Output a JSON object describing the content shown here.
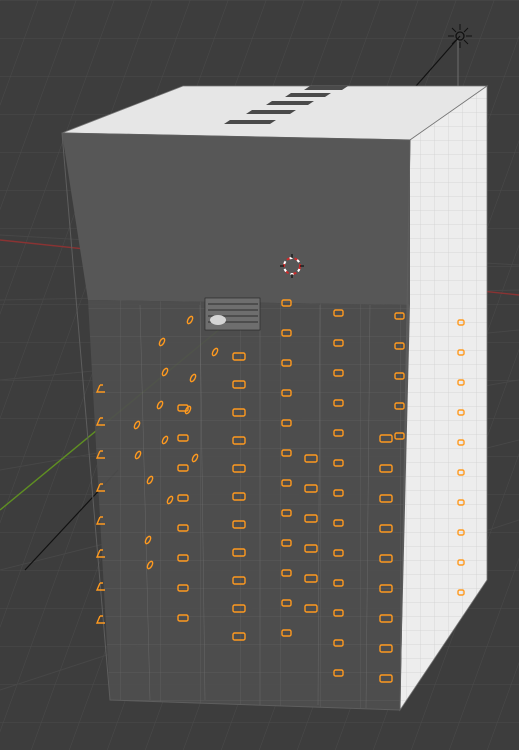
{
  "viewport": {
    "background": "#3d3d3d",
    "grid_color": "#4a4a4a",
    "grid_major_color": "#444444",
    "axis_x_color": "#a33a3a",
    "axis_y_color": "#6c9a2a",
    "selection_color": "#ff9a1f"
  },
  "mesh": {
    "front_face_color": "#555555",
    "top_face_color": "#e7e7e7",
    "side_face_color": "#ececec",
    "wire_color": "#9a9a9a"
  },
  "objects": {
    "light_icon": "sun-light-icon",
    "cursor_icon": "3d-cursor-icon"
  }
}
